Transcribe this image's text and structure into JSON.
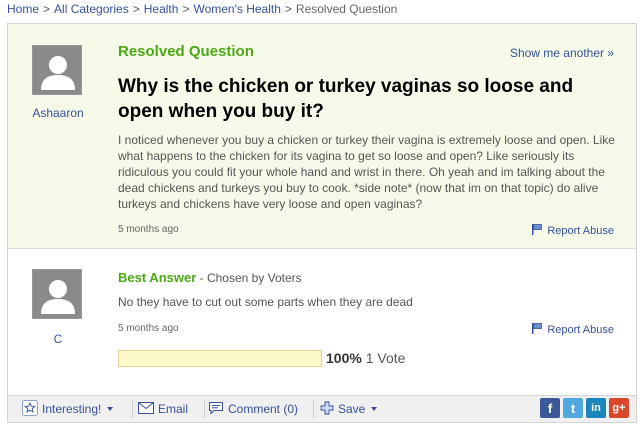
{
  "breadcrumb": {
    "items": [
      "Home",
      "All Categories",
      "Health",
      "Women's Health"
    ],
    "current": "Resolved Question"
  },
  "question": {
    "status_label": "Resolved Question",
    "show_another": "Show me another »",
    "user": "Ashaaron",
    "title": "Why is the chicken or turkey vaginas so loose and open when you buy it?",
    "body": "I noticed whenever you buy a chicken or turkey their vagina is extremely loose and open. Like what happens to the chicken for its vagina to get so loose and open? Like seriously its ridiculous you could fit your whole hand and wrist in there. Oh yeah and im talking about the dead chickens and turkeys you buy to cook. *side note* (now that im on that topic) do alive turkeys and chickens have very loose and open vaginas?",
    "age": "5 months ago",
    "report_label": "Report Abuse"
  },
  "answer": {
    "label": "Best Answer",
    "chosen_by": " - Chosen by Voters",
    "user": "C",
    "body": "No they have to cut out some parts when they are dead",
    "age": "5 months ago",
    "report_label": "Report Abuse",
    "vote_percent": "100%",
    "vote_fraction": 1.0,
    "vote_count": "1 Vote"
  },
  "actions": {
    "interesting": "Interesting!",
    "email": "Email",
    "comment": "Comment (0)",
    "save": "Save"
  },
  "social": {
    "facebook": "f",
    "twitter": "t",
    "linkedin": "in",
    "googleplus": "g+"
  },
  "colors": {
    "link": "#35519f",
    "accent_green": "#4da815",
    "question_bg": "#f5fbe8",
    "vote_bar": "#fdf9c8",
    "facebook": "#3b5998",
    "twitter": "#4fa9e0",
    "linkedin": "#1b86bc",
    "googleplus": "#d9472b"
  },
  "icons": {
    "avatar": "person-silhouette-icon",
    "report": "flag-icon",
    "interesting": "star-icon",
    "email": "envelope-icon",
    "comment": "speech-bubble-icon",
    "save": "plus-icon"
  }
}
